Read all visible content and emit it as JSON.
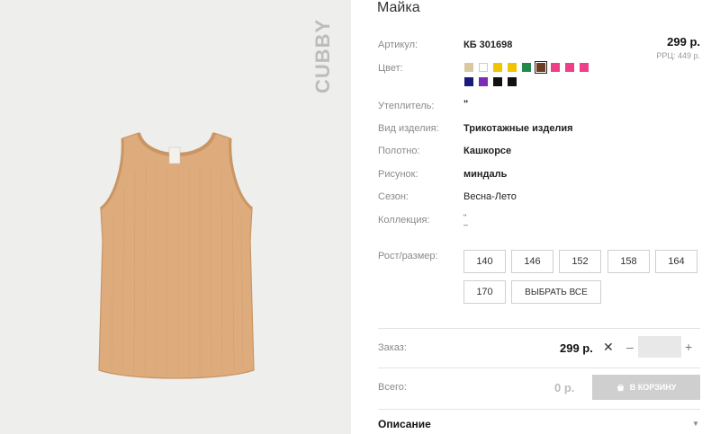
{
  "product": {
    "title": "Майка",
    "brand": "CUBBY"
  },
  "attributes": {
    "article_label": "Артикул:",
    "article_value": "КБ 301698",
    "color_label": "Цвет:",
    "insulation_label": "Утеплитель:",
    "insulation_value": "\"",
    "type_label": "Вид изделия:",
    "type_value": "Трикотажные изделия",
    "fabric_label": "Полотно:",
    "fabric_value": "Кашкорсе",
    "pattern_label": "Рисунок:",
    "pattern_value": "миндаль",
    "season_label": "Сезон:",
    "season_value": "Весна-Лето",
    "collection_label": "Коллекция:",
    "collection_value": "\"",
    "size_label": "Рост/размер:"
  },
  "price": {
    "main": "299 р.",
    "rrp": "РРЦ: 449 р."
  },
  "swatches": {
    "row1": [
      "#d9c9a0",
      "#ffffff",
      "#f2c400",
      "#f2c400",
      "#1f8a4c",
      "#6b3d22",
      "#ef3f86",
      "#ef3f86",
      "#ef3f86"
    ],
    "row2": [
      "#1b1b7c",
      "#7b2bb5",
      "#111111",
      "#111111"
    ],
    "selected_color": "#6b3d22"
  },
  "sizes": {
    "options": [
      "140",
      "146",
      "152",
      "158",
      "164",
      "170"
    ],
    "select_all": "ВЫБРАТЬ ВСЕ"
  },
  "order": {
    "label": "Заказ:",
    "price": "299 р.",
    "times": "✕",
    "minus": "–",
    "plus": "+",
    "qty": ""
  },
  "total": {
    "label": "Всего:",
    "value": "0 р.",
    "cart_button": "В КОРЗИНУ"
  },
  "description": {
    "title": "Описание",
    "chevron": "▼"
  }
}
